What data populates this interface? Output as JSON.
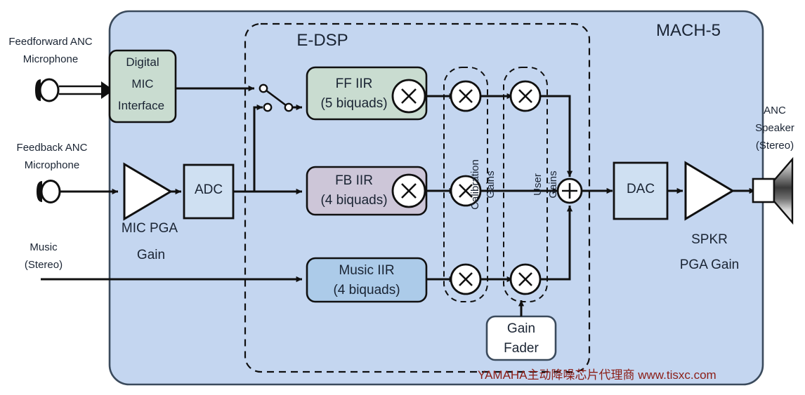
{
  "diagram": {
    "title": "MACH-5",
    "dsp_title": "E-DSP",
    "watermark": "YAMAHA主动降噪芯片代理商 www.tisxc.com"
  },
  "colors": {
    "panel_fill": "#c4d6f0",
    "panel_stroke": "#3a4a5c",
    "green_block": "#c9dcd0",
    "mauve_block": "#cdc6d8",
    "blue_block": "#accbe9",
    "adc_fill": "#cfe0f2",
    "dac_fill": "#cfe0f2",
    "white_fill": "#ffffff",
    "line": "#101010",
    "text": "#1a2433",
    "watermark": "#8b1d16"
  },
  "inputs": {
    "feedforward": {
      "line1": "Feedforward ANC",
      "line2": "Microphone",
      "icon": "microphone-icon"
    },
    "feedback": {
      "line1": "Feedback ANC",
      "line2": "Microphone",
      "icon": "microphone-icon"
    },
    "music": {
      "line1": "Music",
      "line2": "(Stereo)"
    }
  },
  "outputs": {
    "speaker": {
      "line1": "ANC",
      "line2": "Speaker",
      "line3": "(Stereo)",
      "icon": "speaker-icon"
    }
  },
  "blocks": {
    "digital_mic": {
      "l1": "Digital",
      "l2": "MIC",
      "l3": "Interface"
    },
    "mic_pga": {
      "l1": "MIC PGA",
      "l2": "Gain"
    },
    "adc": {
      "label": "ADC"
    },
    "ff_iir": {
      "l1": "FF IIR",
      "l2": "(5 biquads)"
    },
    "fb_iir": {
      "l1": "FB IIR",
      "l2": "(4 biquads)"
    },
    "music_iir": {
      "l1": "Music IIR",
      "l2": "(4 biquads)"
    },
    "dac": {
      "label": "DAC"
    },
    "spkr_pga": {
      "l1": "SPKR",
      "l2": "PGA Gain"
    },
    "gain_fader": {
      "l1": "Gain",
      "l2": "Fader"
    }
  },
  "groups": {
    "calibration_gains": {
      "l1": "Calibration",
      "l2": "Gains"
    },
    "user_gains": {
      "l1": "User",
      "l2": "Gains"
    }
  },
  "operators": {
    "multiply": "×",
    "sum": "+"
  }
}
